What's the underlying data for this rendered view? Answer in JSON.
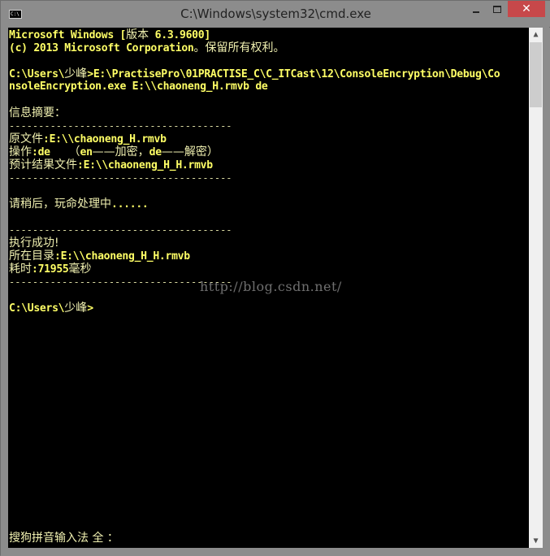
{
  "window": {
    "title": "C:\\Windows\\system32\\cmd.exe",
    "icon_label": "C:\\",
    "buttons": {
      "minimize": "minimize",
      "maximize": "maximize",
      "close": "✕"
    }
  },
  "console": {
    "lines": [
      {
        "segments": [
          {
            "t": "Microsoft Windows [",
            "k": "y"
          },
          {
            "t": "版本",
            "k": "c"
          },
          {
            "t": " 6.3.9600]",
            "k": "y"
          }
        ]
      },
      {
        "segments": [
          {
            "t": "(c) 2013 Microsoft Corporation",
            "k": "y"
          },
          {
            "t": "。保留所有权利。",
            "k": "c"
          }
        ]
      },
      {
        "segments": []
      },
      {
        "segments": [
          {
            "t": "C:\\Users\\",
            "k": "y"
          },
          {
            "t": "少峰",
            "k": "c"
          },
          {
            "t": ">E:\\PractisePro\\01PRACTISE_C\\C_ITCast\\12\\ConsoleEncryption\\Debug\\Co",
            "k": "y"
          }
        ]
      },
      {
        "segments": [
          {
            "t": "nsoleEncryption.exe E:\\\\chaoneng_H.rmvb de",
            "k": "y"
          }
        ]
      },
      {
        "segments": []
      },
      {
        "segments": [
          {
            "t": "信息摘要：",
            "k": "c"
          }
        ]
      },
      {
        "segments": [
          {
            "t": "--------------------------------------",
            "k": "dash"
          }
        ]
      },
      {
        "segments": [
          {
            "t": "原文件",
            "k": "c"
          },
          {
            "t": ":E:\\\\chaoneng_H.rmvb",
            "k": "y"
          }
        ]
      },
      {
        "segments": [
          {
            "t": "操作",
            "k": "c"
          },
          {
            "t": ":de   ",
            "k": "y"
          },
          {
            "t": "（",
            "k": "c"
          },
          {
            "t": "en",
            "k": "y"
          },
          {
            "t": "——加密，",
            "k": "c"
          },
          {
            "t": "de",
            "k": "y"
          },
          {
            "t": "——解密）",
            "k": "c"
          }
        ]
      },
      {
        "segments": [
          {
            "t": "预计结果文件",
            "k": "c"
          },
          {
            "t": ":E:\\\\chaoneng_H_H.rmvb",
            "k": "y"
          }
        ]
      },
      {
        "segments": [
          {
            "t": "--------------------------------------",
            "k": "dash"
          }
        ]
      },
      {
        "segments": []
      },
      {
        "segments": [
          {
            "t": "请稍后，玩命处理中",
            "k": "c"
          },
          {
            "t": "......",
            "k": "y"
          }
        ]
      },
      {
        "segments": []
      },
      {
        "segments": [
          {
            "t": "--------------------------------------",
            "k": "dash"
          }
        ]
      },
      {
        "segments": [
          {
            "t": "执行成功!",
            "k": "c"
          }
        ]
      },
      {
        "segments": [
          {
            "t": "所在目录",
            "k": "c"
          },
          {
            "t": ":E:\\\\chaoneng_H_H.rmvb",
            "k": "y"
          }
        ]
      },
      {
        "segments": [
          {
            "t": "耗时",
            "k": "c"
          },
          {
            "t": ":71955",
            "k": "y"
          },
          {
            "t": "毫秒",
            "k": "c"
          }
        ]
      },
      {
        "segments": [
          {
            "t": "--------------------------------------",
            "k": "dash"
          }
        ]
      },
      {
        "segments": []
      },
      {
        "segments": [
          {
            "t": "C:\\Users\\",
            "k": "y"
          },
          {
            "t": "少峰",
            "k": "c"
          },
          {
            "t": ">",
            "k": "y"
          }
        ]
      }
    ],
    "ime_status": "搜狗拼音输入法 全 ："
  },
  "watermark": "http://blog.csdn.net/",
  "scrollbar": {
    "up": "⌃",
    "down": "⌄",
    "position_fraction": 0.0
  }
}
